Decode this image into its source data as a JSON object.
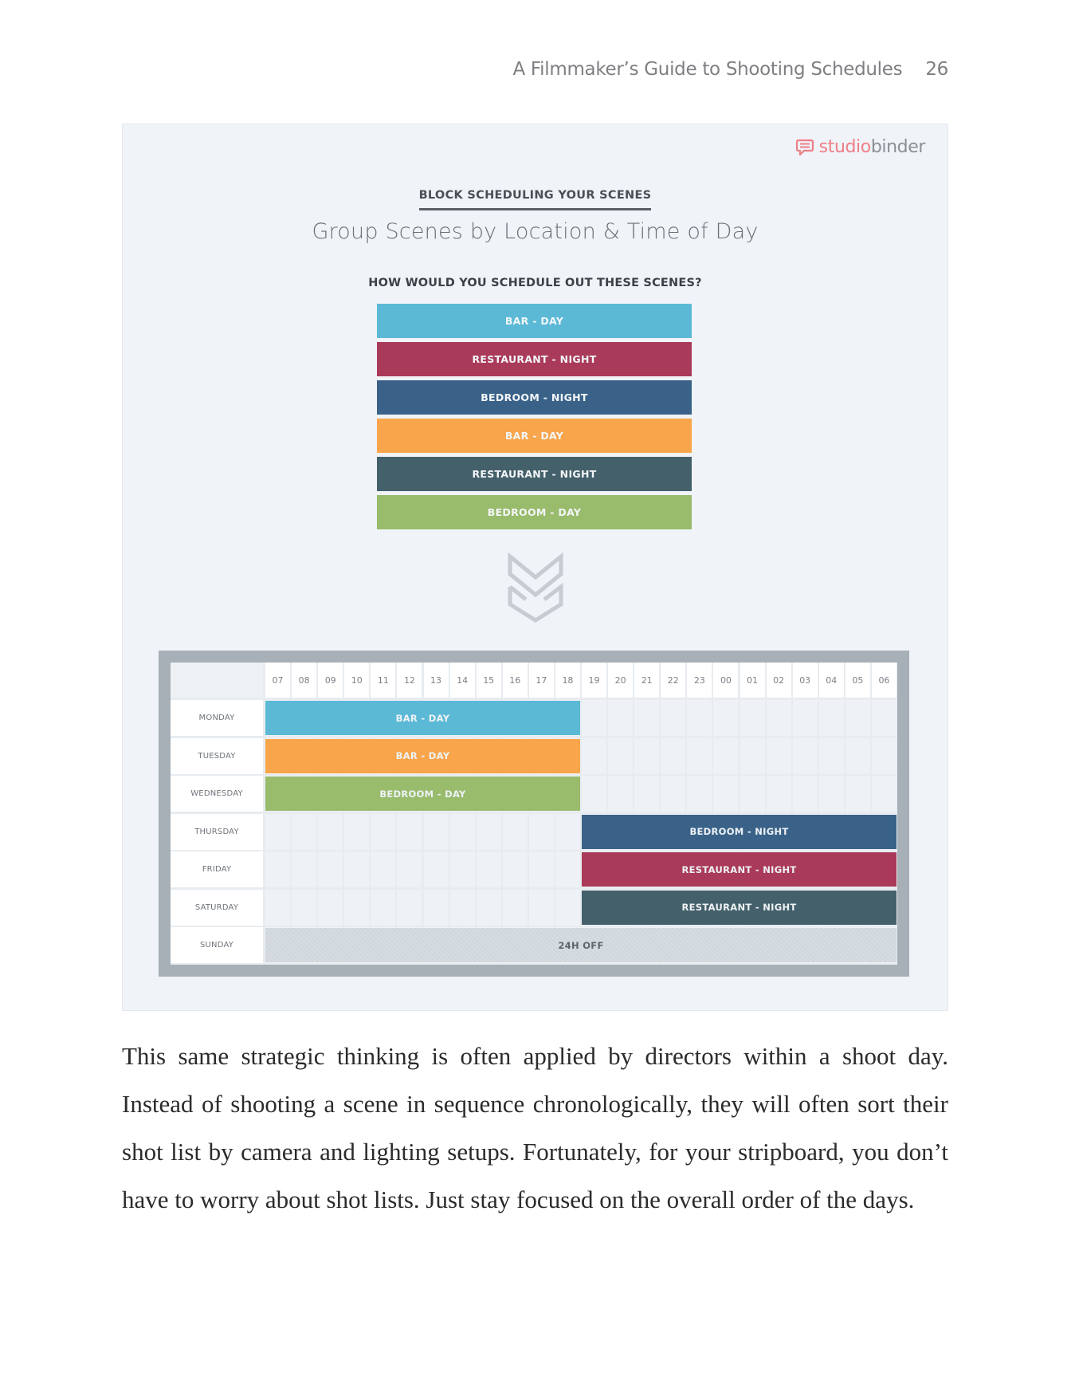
{
  "header": {
    "book_title": "A Filmmaker’s Guide to Shooting Schedules",
    "page_number": "26"
  },
  "infographic": {
    "logo": {
      "icon": "speech-bubble-icon",
      "part1": "studio",
      "part2": "binder",
      "color_primary": "#ee7f88",
      "color_secondary": "#8b8f94"
    },
    "kicker": "BLOCK SCHEDULING YOUR SCENES",
    "title": "Group Scenes by Location & Time of Day",
    "question": "HOW WOULD YOU SCHEDULE OUT THESE SCENES?",
    "scenes": [
      {
        "label": "BAR - DAY",
        "color": "#5bb9d6"
      },
      {
        "label": "RESTAURANT - NIGHT",
        "color": "#aa3a5a"
      },
      {
        "label": "BEDROOM - NIGHT",
        "color": "#3a6289"
      },
      {
        "label": "BAR - DAY",
        "color": "#f9a54c"
      },
      {
        "label": "RESTAURANT - NIGHT",
        "color": "#44606b"
      },
      {
        "label": "BEDROOM - DAY",
        "color": "#98bb6c"
      }
    ],
    "arrow_icon": "double-chevron-down-icon",
    "schedule": {
      "hours": [
        "07",
        "08",
        "09",
        "10",
        "11",
        "12",
        "13",
        "14",
        "15",
        "16",
        "17",
        "18",
        "19",
        "20",
        "21",
        "22",
        "23",
        "00",
        "01",
        "02",
        "03",
        "04",
        "05",
        "06"
      ],
      "days": [
        "MONDAY",
        "TUESDAY",
        "WEDNESDAY",
        "THURSDAY",
        "FRIDAY",
        "SATURDAY",
        "SUNDAY"
      ],
      "blocks": [
        {
          "day": "MONDAY",
          "label": "BAR - DAY",
          "start_hour": "07",
          "end_hour": "18",
          "color": "#5bb9d6"
        },
        {
          "day": "TUESDAY",
          "label": "BAR - DAY",
          "start_hour": "07",
          "end_hour": "18",
          "color": "#f9a54c"
        },
        {
          "day": "WEDNESDAY",
          "label": "BEDROOM - DAY",
          "start_hour": "07",
          "end_hour": "18",
          "color": "#98bb6c"
        },
        {
          "day": "THURSDAY",
          "label": "BEDROOM - NIGHT",
          "start_hour": "19",
          "end_hour": "06",
          "color": "#3a6289"
        },
        {
          "day": "FRIDAY",
          "label": "RESTAURANT - NIGHT",
          "start_hour": "19",
          "end_hour": "06",
          "color": "#aa3a5a"
        },
        {
          "day": "SATURDAY",
          "label": "RESTAURANT - NIGHT",
          "start_hour": "19",
          "end_hour": "06",
          "color": "#44606b"
        },
        {
          "day": "SUNDAY",
          "label": "24H OFF",
          "start_hour": "07",
          "end_hour": "06",
          "color": "#cfd6dc",
          "off": true
        }
      ]
    }
  },
  "body": {
    "paragraph": "This same strategic thinking is often applied by directors within a shoot day. Instead of shooting a scene in sequence chronologically, they will often sort their shot list by camera and lighting setups. Fortunately, for your stripboard, you don’t have to worry about shot lists. Just stay focused on the overall order of the days."
  }
}
